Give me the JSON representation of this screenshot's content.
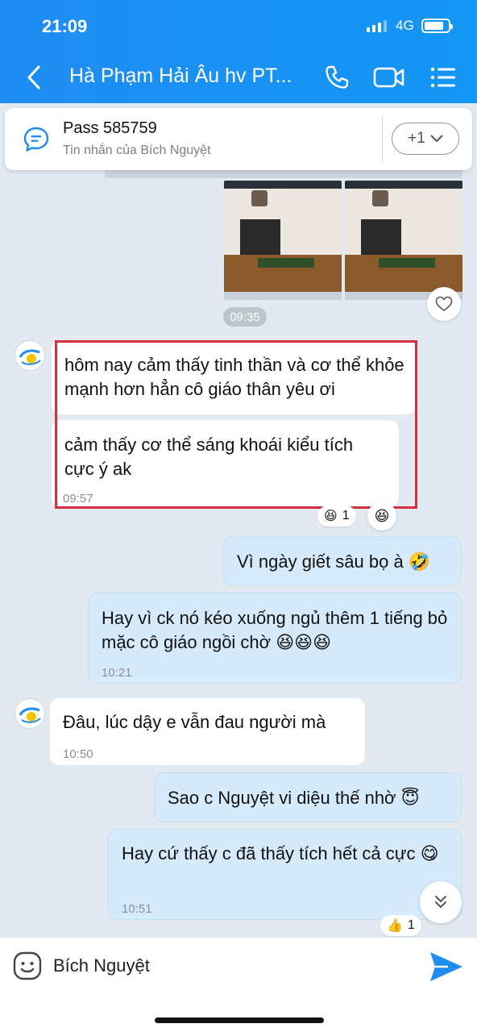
{
  "status_bar": {
    "time": "21:09",
    "network": "4G"
  },
  "header": {
    "title": "Hà Phạm Hải Âu hv PT..."
  },
  "pinned": {
    "title": "Pass 585759",
    "subtitle": "Tin nhắn của Bích Nguyệt",
    "more_label": "+1"
  },
  "images": {
    "time": "09:35"
  },
  "messages": [
    {
      "side": "in",
      "text": "hôm nay cảm thấy tinh thần và cơ thể khỏe mạnh hơn hẳn cô giáo thân yêu ơi",
      "time": ""
    },
    {
      "side": "in",
      "text": "cảm thấy cơ thể sáng khoái kiểu tích cực ý ak",
      "time": "09:57",
      "reaction_count": "1"
    },
    {
      "side": "out",
      "text": "Vì ngày giết sâu bọ à 🤣",
      "time": ""
    },
    {
      "side": "out",
      "text": "Hay vì ck nó kéo xuống ngủ thêm 1 tiếng bỏ mặc cô giáo ngồi chờ 😆😆😆",
      "time": "10:21"
    },
    {
      "side": "in",
      "text": "Đâu, lúc dậy e vẫn đau người mà",
      "time": "10:50"
    },
    {
      "side": "out",
      "text": "Sao c Nguyệt vi diệu thế nhờ 😇",
      "time": ""
    },
    {
      "side": "out",
      "text": "Hay cứ thấy c đã thấy tích hết cả cực 😋",
      "time": "10:51",
      "reaction_count": "1"
    }
  ],
  "input": {
    "value": "Bích Nguyệt"
  },
  "colors": {
    "header": "#1f8cf1",
    "outgoing_bubble": "#d5ebfc",
    "highlight": "#d32f3f",
    "send": "#1f8cf1"
  }
}
